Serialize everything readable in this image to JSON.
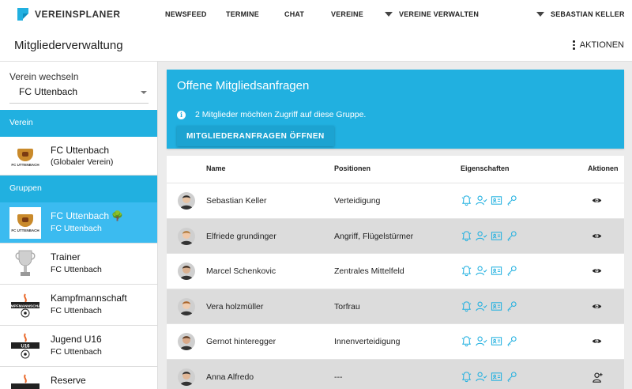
{
  "brand": {
    "name": "VEREINSPLANER",
    "accent": "#21b0e0"
  },
  "nav": {
    "newsfeed": "NEWSFEED",
    "termine": "TERMINE",
    "chat": "CHAT",
    "vereine": "VEREINE",
    "vereine_verwalten": "VEREINE VERWALTEN",
    "user": "SEBASTIAN KELLER"
  },
  "page": {
    "title": "Mitgliederverwaltung",
    "actions_label": "AKTIONEN"
  },
  "sidebar": {
    "switch_label": "Verein wechseln",
    "selected_club": "FC Uttenbach",
    "section_verein": "Verein",
    "club": {
      "name": "FC Uttenbach",
      "sub": "(Globaler Verein)"
    },
    "section_gruppen": "Gruppen",
    "groups": [
      {
        "name": "FC Uttenbach 🌳",
        "club": "FC Uttenbach",
        "icon": "club-crest-icon"
      },
      {
        "name": "Trainer",
        "club": "FC Uttenbach",
        "icon": "trophy-icon"
      },
      {
        "name": "Kampfmannschaft",
        "club": "FC Uttenbach",
        "icon": "kampfmannschaft-badge-icon"
      },
      {
        "name": "Jugend U16",
        "club": "FC Uttenbach",
        "icon": "u16-badge-icon"
      },
      {
        "name": "Reserve",
        "club": "",
        "icon": "reserve-badge-icon"
      }
    ]
  },
  "requests": {
    "title": "Offene Mitgliedsanfragen",
    "info": "2 Mitglieder möchten Zugriff auf diese Gruppe.",
    "button": "MITGLIEDERANFRAGEN ÖFFNEN"
  },
  "table": {
    "headers": {
      "name": "Name",
      "positions": "Positionen",
      "properties": "Eigenschaften",
      "actions": "Aktionen"
    },
    "rows": [
      {
        "name": "Sebastian Keller",
        "positions": "Verteidigung",
        "action": "eye-icon"
      },
      {
        "name": "Elfriede grundinger",
        "positions": "Angriff, Flügelstürmer",
        "action": "eye-icon"
      },
      {
        "name": "Marcel Schenkovic",
        "positions": "Zentrales Mittelfeld",
        "action": "eye-icon"
      },
      {
        "name": "Vera holzmüller",
        "positions": "Torfrau",
        "action": "eye-icon"
      },
      {
        "name": "Gernot hinteregger",
        "positions": "Innenverteidigung",
        "action": "eye-icon"
      },
      {
        "name": "Anna Alfredo",
        "positions": "---",
        "action": "add-person-icon"
      }
    ]
  }
}
